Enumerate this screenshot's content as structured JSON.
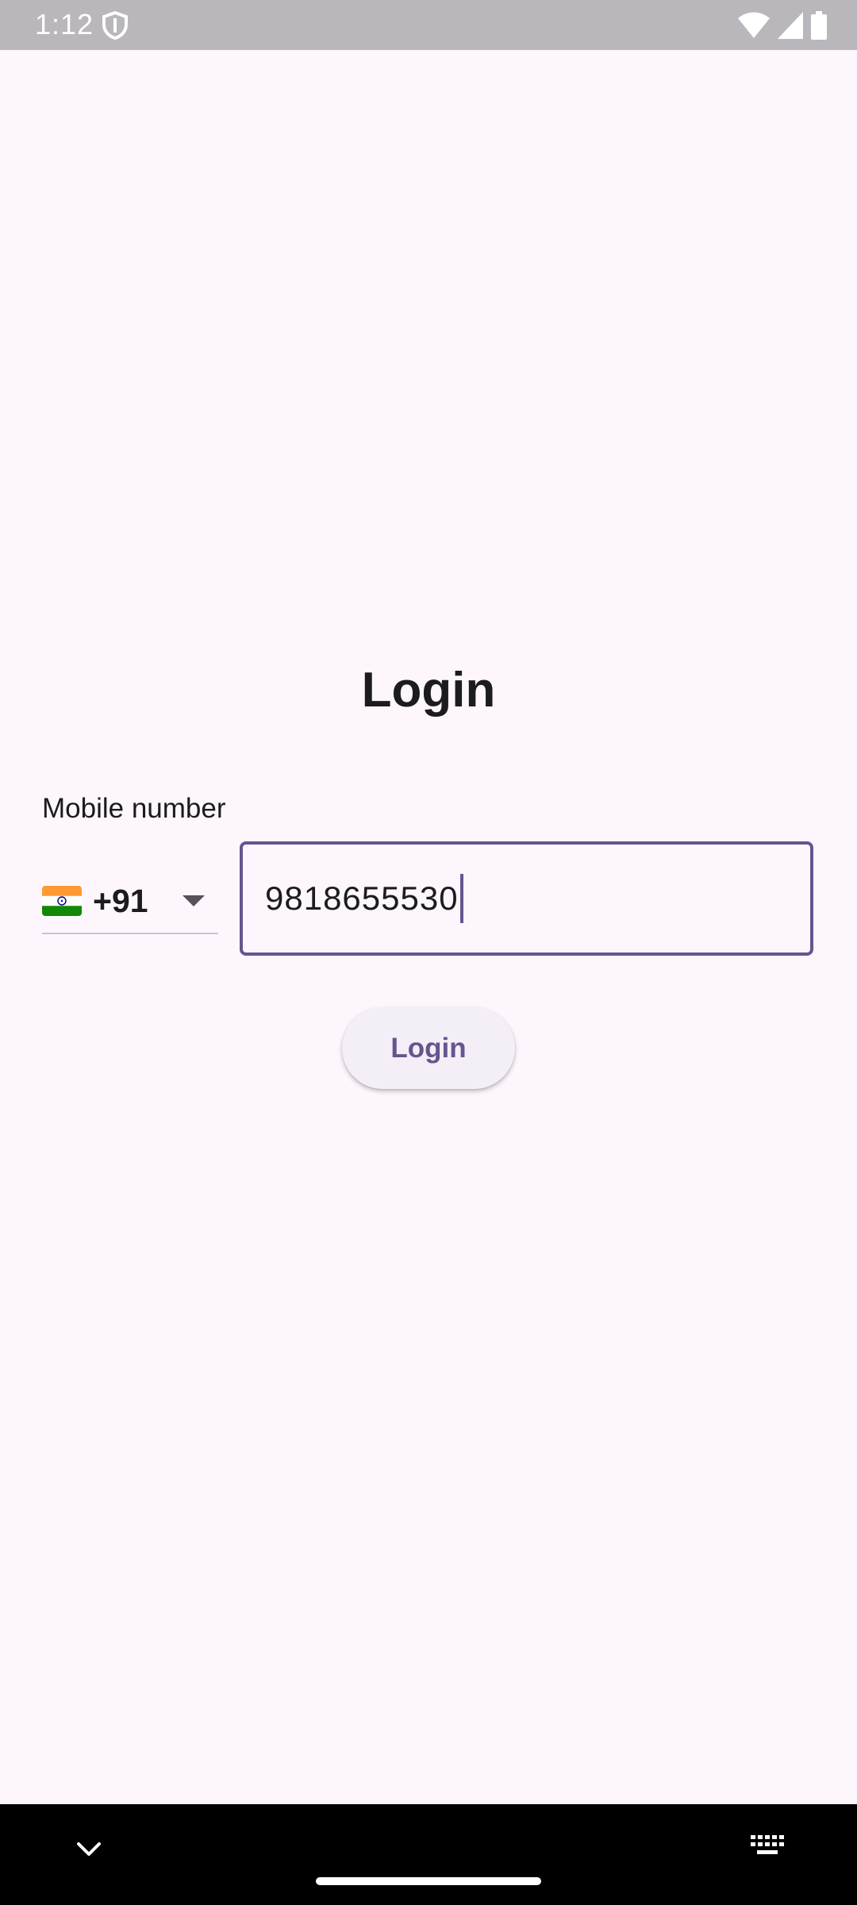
{
  "status_bar": {
    "time": "1:12",
    "left_icons": [
      "shield-icon"
    ],
    "right_icons": [
      "wifi-icon",
      "cell-signal-icon",
      "battery-icon"
    ]
  },
  "page": {
    "title": "Login"
  },
  "form": {
    "label": "Mobile number",
    "country": {
      "flag": "india-flag-icon",
      "dial_code": "+91"
    },
    "phone_value": "9818655530",
    "login_button_label": "Login"
  },
  "nav_bar": {
    "icons": [
      "chevron-down-icon",
      "home-handle",
      "keyboard-icon"
    ]
  },
  "colors": {
    "background": "#fdf7fd",
    "accent": "#65558f",
    "text": "#1c1b1f",
    "status_bar": "#b9b6bc",
    "nav_bar": "#000000"
  }
}
